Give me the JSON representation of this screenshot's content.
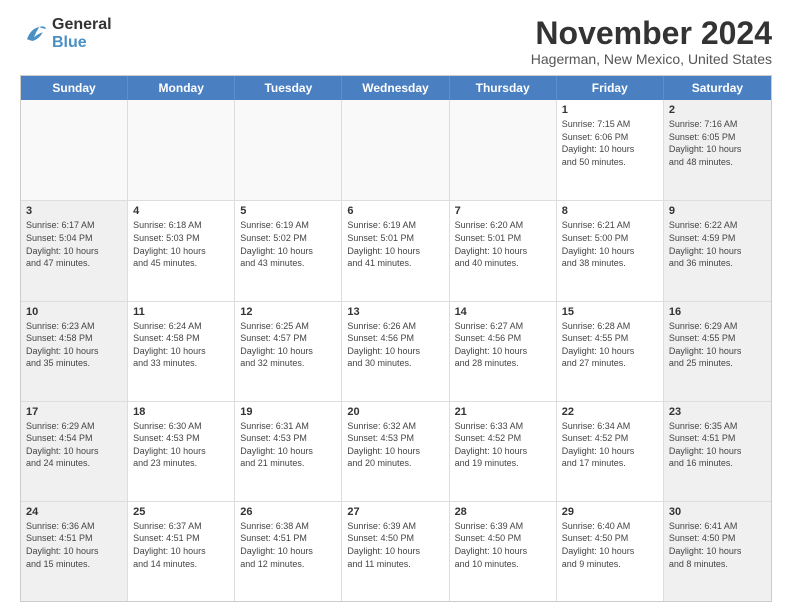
{
  "logo": {
    "line1": "General",
    "line2": "Blue"
  },
  "title": "November 2024",
  "location": "Hagerman, New Mexico, United States",
  "header_days": [
    "Sunday",
    "Monday",
    "Tuesday",
    "Wednesday",
    "Thursday",
    "Friday",
    "Saturday"
  ],
  "weeks": [
    [
      {
        "day": "",
        "info": "",
        "empty": true
      },
      {
        "day": "",
        "info": "",
        "empty": true
      },
      {
        "day": "",
        "info": "",
        "empty": true
      },
      {
        "day": "",
        "info": "",
        "empty": true
      },
      {
        "day": "",
        "info": "",
        "empty": true
      },
      {
        "day": "1",
        "info": "Sunrise: 7:15 AM\nSunset: 6:06 PM\nDaylight: 10 hours\nand 50 minutes.",
        "empty": false
      },
      {
        "day": "2",
        "info": "Sunrise: 7:16 AM\nSunset: 6:05 PM\nDaylight: 10 hours\nand 48 minutes.",
        "empty": false
      }
    ],
    [
      {
        "day": "3",
        "info": "Sunrise: 6:17 AM\nSunset: 5:04 PM\nDaylight: 10 hours\nand 47 minutes.",
        "empty": false
      },
      {
        "day": "4",
        "info": "Sunrise: 6:18 AM\nSunset: 5:03 PM\nDaylight: 10 hours\nand 45 minutes.",
        "empty": false
      },
      {
        "day": "5",
        "info": "Sunrise: 6:19 AM\nSunset: 5:02 PM\nDaylight: 10 hours\nand 43 minutes.",
        "empty": false
      },
      {
        "day": "6",
        "info": "Sunrise: 6:19 AM\nSunset: 5:01 PM\nDaylight: 10 hours\nand 41 minutes.",
        "empty": false
      },
      {
        "day": "7",
        "info": "Sunrise: 6:20 AM\nSunset: 5:01 PM\nDaylight: 10 hours\nand 40 minutes.",
        "empty": false
      },
      {
        "day": "8",
        "info": "Sunrise: 6:21 AM\nSunset: 5:00 PM\nDaylight: 10 hours\nand 38 minutes.",
        "empty": false
      },
      {
        "day": "9",
        "info": "Sunrise: 6:22 AM\nSunset: 4:59 PM\nDaylight: 10 hours\nand 36 minutes.",
        "empty": false
      }
    ],
    [
      {
        "day": "10",
        "info": "Sunrise: 6:23 AM\nSunset: 4:58 PM\nDaylight: 10 hours\nand 35 minutes.",
        "empty": false
      },
      {
        "day": "11",
        "info": "Sunrise: 6:24 AM\nSunset: 4:58 PM\nDaylight: 10 hours\nand 33 minutes.",
        "empty": false
      },
      {
        "day": "12",
        "info": "Sunrise: 6:25 AM\nSunset: 4:57 PM\nDaylight: 10 hours\nand 32 minutes.",
        "empty": false
      },
      {
        "day": "13",
        "info": "Sunrise: 6:26 AM\nSunset: 4:56 PM\nDaylight: 10 hours\nand 30 minutes.",
        "empty": false
      },
      {
        "day": "14",
        "info": "Sunrise: 6:27 AM\nSunset: 4:56 PM\nDaylight: 10 hours\nand 28 minutes.",
        "empty": false
      },
      {
        "day": "15",
        "info": "Sunrise: 6:28 AM\nSunset: 4:55 PM\nDaylight: 10 hours\nand 27 minutes.",
        "empty": false
      },
      {
        "day": "16",
        "info": "Sunrise: 6:29 AM\nSunset: 4:55 PM\nDaylight: 10 hours\nand 25 minutes.",
        "empty": false
      }
    ],
    [
      {
        "day": "17",
        "info": "Sunrise: 6:29 AM\nSunset: 4:54 PM\nDaylight: 10 hours\nand 24 minutes.",
        "empty": false
      },
      {
        "day": "18",
        "info": "Sunrise: 6:30 AM\nSunset: 4:53 PM\nDaylight: 10 hours\nand 23 minutes.",
        "empty": false
      },
      {
        "day": "19",
        "info": "Sunrise: 6:31 AM\nSunset: 4:53 PM\nDaylight: 10 hours\nand 21 minutes.",
        "empty": false
      },
      {
        "day": "20",
        "info": "Sunrise: 6:32 AM\nSunset: 4:53 PM\nDaylight: 10 hours\nand 20 minutes.",
        "empty": false
      },
      {
        "day": "21",
        "info": "Sunrise: 6:33 AM\nSunset: 4:52 PM\nDaylight: 10 hours\nand 19 minutes.",
        "empty": false
      },
      {
        "day": "22",
        "info": "Sunrise: 6:34 AM\nSunset: 4:52 PM\nDaylight: 10 hours\nand 17 minutes.",
        "empty": false
      },
      {
        "day": "23",
        "info": "Sunrise: 6:35 AM\nSunset: 4:51 PM\nDaylight: 10 hours\nand 16 minutes.",
        "empty": false
      }
    ],
    [
      {
        "day": "24",
        "info": "Sunrise: 6:36 AM\nSunset: 4:51 PM\nDaylight: 10 hours\nand 15 minutes.",
        "empty": false
      },
      {
        "day": "25",
        "info": "Sunrise: 6:37 AM\nSunset: 4:51 PM\nDaylight: 10 hours\nand 14 minutes.",
        "empty": false
      },
      {
        "day": "26",
        "info": "Sunrise: 6:38 AM\nSunset: 4:51 PM\nDaylight: 10 hours\nand 12 minutes.",
        "empty": false
      },
      {
        "day": "27",
        "info": "Sunrise: 6:39 AM\nSunset: 4:50 PM\nDaylight: 10 hours\nand 11 minutes.",
        "empty": false
      },
      {
        "day": "28",
        "info": "Sunrise: 6:39 AM\nSunset: 4:50 PM\nDaylight: 10 hours\nand 10 minutes.",
        "empty": false
      },
      {
        "day": "29",
        "info": "Sunrise: 6:40 AM\nSunset: 4:50 PM\nDaylight: 10 hours\nand 9 minutes.",
        "empty": false
      },
      {
        "day": "30",
        "info": "Sunrise: 6:41 AM\nSunset: 4:50 PM\nDaylight: 10 hours\nand 8 minutes.",
        "empty": false
      }
    ]
  ]
}
